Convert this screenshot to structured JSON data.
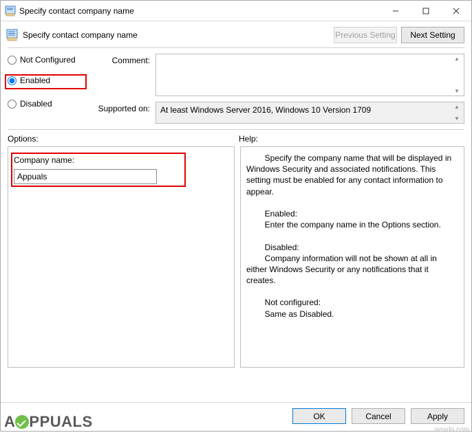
{
  "titlebar": {
    "title": "Specify contact company name"
  },
  "header": {
    "policy_title": "Specify contact company name",
    "prev_btn": "Previous Setting",
    "next_btn": "Next Setting"
  },
  "radios": {
    "not_configured": "Not Configured",
    "enabled": "Enabled",
    "disabled": "Disabled",
    "selected": "enabled"
  },
  "meta": {
    "comment_label": "Comment:",
    "comment_value": "",
    "supported_label": "Supported on:",
    "supported_value": "At least Windows Server 2016, Windows 10 Version 1709"
  },
  "labels": {
    "options": "Options:",
    "help": "Help:"
  },
  "options": {
    "company_label": "Company name:",
    "company_value": "Appuals"
  },
  "help": {
    "text": "        Specify the company name that will be displayed in Windows Security and associated notifications. This setting must be enabled for any contact information to appear.\n\n        Enabled:\n        Enter the company name in the Options section.\n\n        Disabled:\n        Company information will not be shown at all in either Windows Security or any notifications that it creates.\n\n        Not configured:\n        Same as Disabled."
  },
  "footer": {
    "ok": "OK",
    "cancel": "Cancel",
    "apply": "Apply"
  },
  "watermark": {
    "brand_pre": "A",
    "brand_post": "PPUALS"
  },
  "source_mark": "wsxdn.com"
}
